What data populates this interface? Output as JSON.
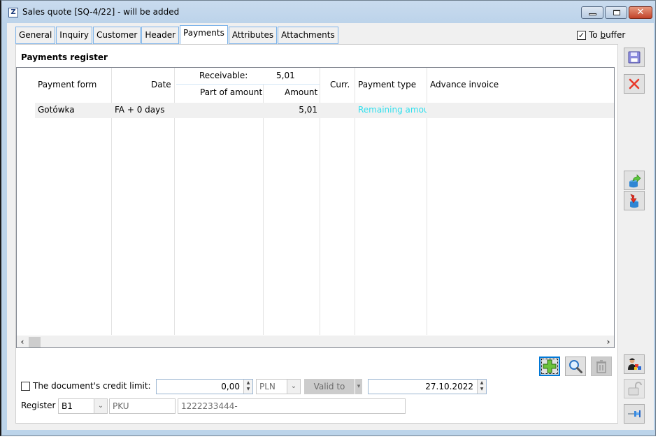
{
  "window": {
    "title": "Sales quote [SQ-4/22] - will be added",
    "app_icon": "Z",
    "controls": {
      "minimize": "minimize-icon",
      "maximize": "maximize-icon",
      "close": "close-icon"
    }
  },
  "tabs": [
    {
      "label": "General",
      "active": false
    },
    {
      "label": "Inquiry",
      "active": false
    },
    {
      "label": "Customer",
      "active": false
    },
    {
      "label": "Header",
      "active": false
    },
    {
      "label": "Payments",
      "active": true
    },
    {
      "label": "Attributes",
      "active": false
    },
    {
      "label": "Attachments",
      "active": false
    }
  ],
  "to_buffer": {
    "label_pre": "To ",
    "label_ul": "b",
    "label_post": "uffer",
    "checked": true,
    "check_glyph": "✓"
  },
  "payments_register": {
    "title": "Payments register",
    "receivable_label": "Receivable:",
    "receivable_value": "5,01",
    "columns": {
      "payment_form": "Payment form",
      "date": "Date",
      "part_of_amount": "Part of amount",
      "amount": "Amount",
      "currency": "Curr.",
      "payment_type": "Payment type",
      "advance_invoice": "Advance invoice"
    },
    "rows": [
      {
        "payment_form": "Gotówka",
        "date": "FA + 0 days",
        "part_of_amount": "",
        "amount": "5,01",
        "currency": "",
        "payment_type": "Remaining amount",
        "advance_invoice": ""
      }
    ],
    "payment_type_color": "#33e0ee",
    "scroll_left": "‹",
    "scroll_right": "›"
  },
  "grid_actions": {
    "add": "add-icon",
    "preview": "magnifier-icon",
    "delete": "trash-icon"
  },
  "credit_limit": {
    "label": "The document's credit limit:",
    "checked": false,
    "value": "0,00",
    "currency": "PLN",
    "valid_to_label": "Valid to",
    "valid_to_value": "27.10.2022"
  },
  "register": {
    "label": "Register",
    "value": "B1",
    "code": "PKU",
    "number": "1222233444-"
  },
  "side_toolbar": {
    "save": "save-icon",
    "cancel": "cancel-icon",
    "export": "export-icon",
    "import": "import-icon",
    "users": "user-group-icon",
    "unlock": "unlock-icon",
    "pin": "pin-icon"
  },
  "colors": {
    "tab_border": "#7eb4ea",
    "focus_blue": "#0078d7",
    "window_frame": "#bcd4ea"
  }
}
